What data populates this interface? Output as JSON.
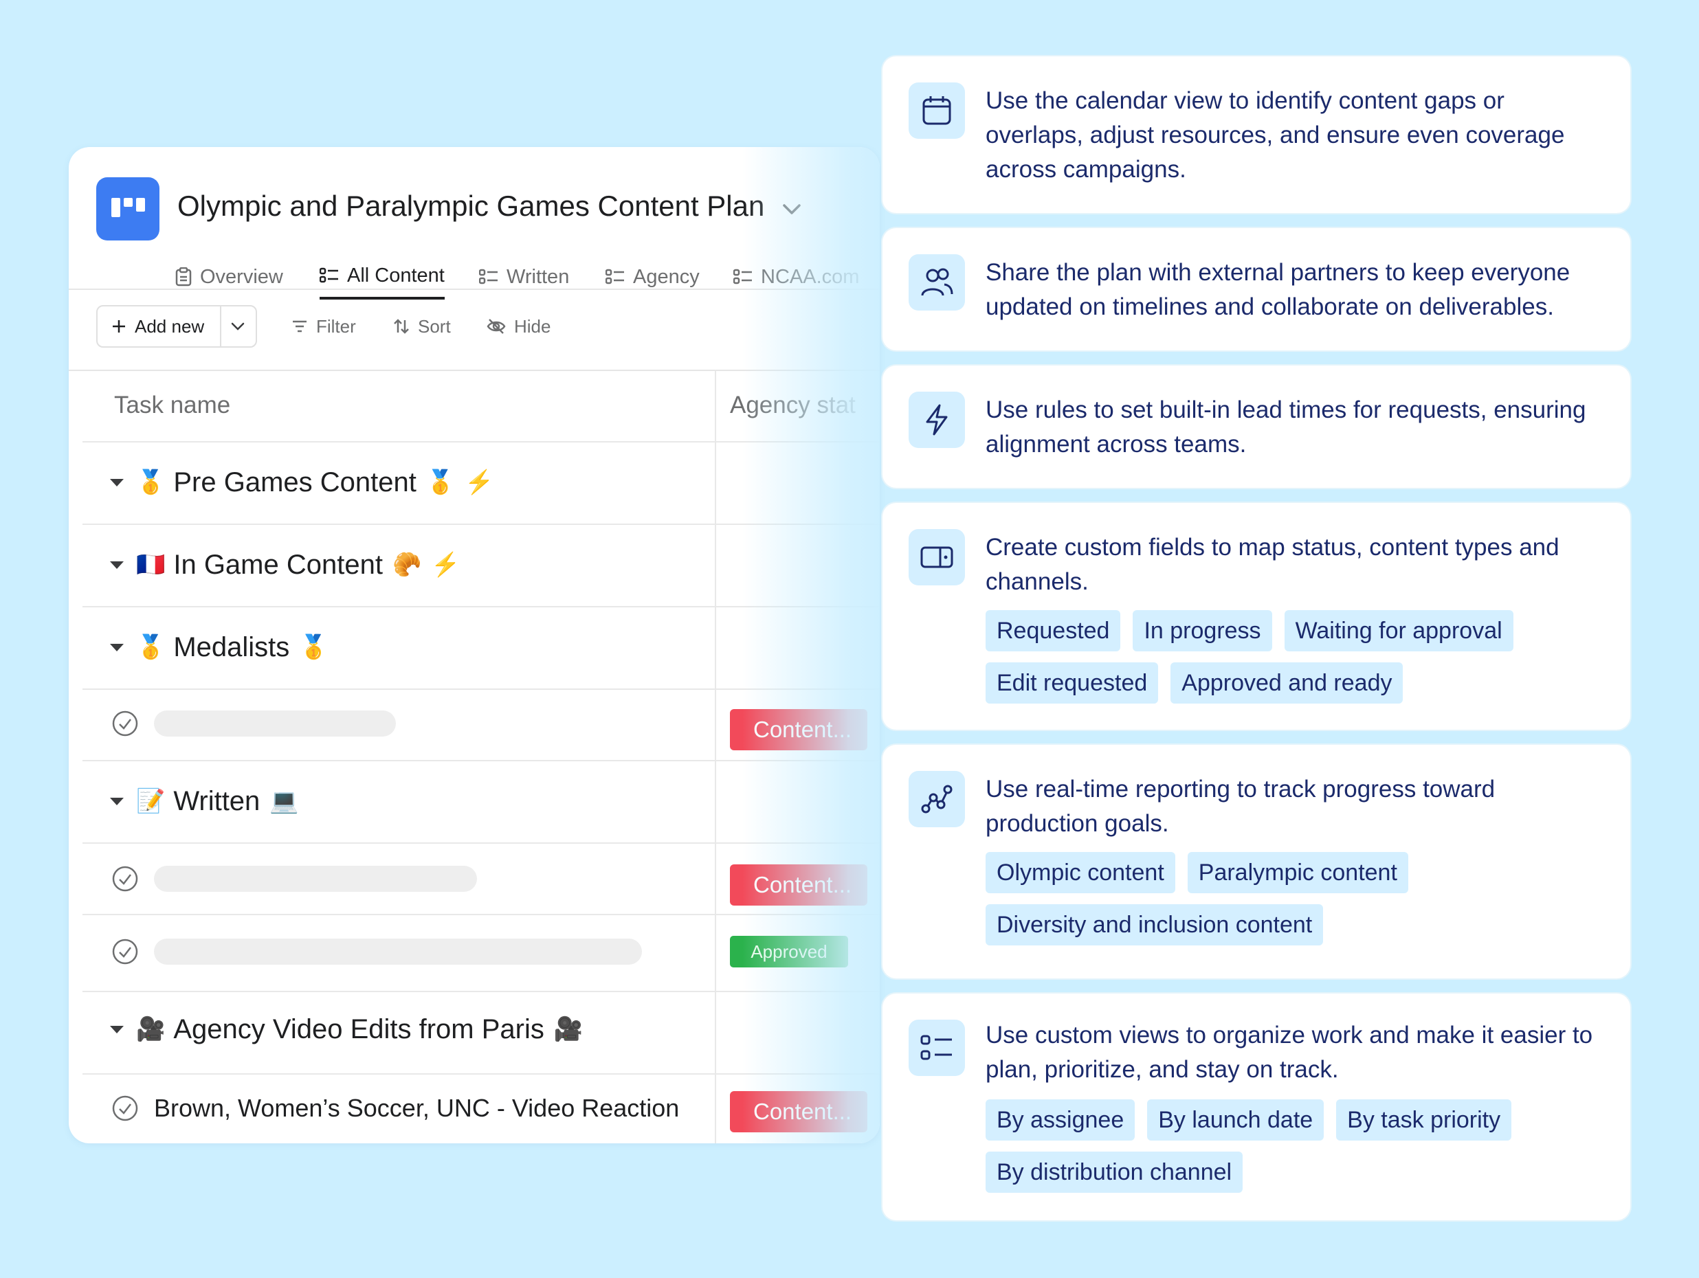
{
  "project": {
    "title": "Olympic and Paralympic Games Content Plan",
    "accent": "#3d7cf2"
  },
  "tabs": [
    {
      "label": "Overview",
      "icon": "overview-icon",
      "active": false
    },
    {
      "label": "All Content",
      "icon": "list-icon",
      "active": true
    },
    {
      "label": "Written",
      "icon": "list-icon",
      "active": false
    },
    {
      "label": "Agency",
      "icon": "list-icon",
      "active": false
    },
    {
      "label": "NCAA.com",
      "icon": "list-icon",
      "active": false
    }
  ],
  "toolbar": {
    "add_new": "Add new",
    "filter": "Filter",
    "sort": "Sort",
    "hide": "Hide"
  },
  "columns": {
    "task_name": "Task name",
    "agency_status": "Agency stat"
  },
  "groups": [
    {
      "label": "Pre Games Content",
      "emoji_left": "🥇",
      "emoji_right": "🥇",
      "emoji_extra": "⚡"
    },
    {
      "label": "In Game Content",
      "emoji_left": "🇫🇷",
      "emoji_right": "🥐",
      "emoji_extra": "⚡"
    },
    {
      "label": "Medalists",
      "emoji_left": "🥇",
      "emoji_right": "🥇"
    },
    {
      "label": "Written",
      "emoji_left": "📝",
      "emoji_right": "💻"
    },
    {
      "label": "Agency Video Edits from Paris",
      "emoji_left": "🎥",
      "emoji_right": "🎥"
    }
  ],
  "rows": [
    {
      "status": "Content..."
    },
    {
      "status": "Content..."
    },
    {
      "status": "Approved"
    },
    {
      "name": "Brown, Women’s Soccer, UNC - Video Reaction",
      "status": "Content..."
    }
  ],
  "status_colors": {
    "content": "#f24a5a",
    "approved": "#2bb24c"
  },
  "cards": [
    {
      "icon": "calendar-icon",
      "text": "Use the calendar view to identify content gaps or overlaps, adjust resources, and ensure even coverage across campaigns."
    },
    {
      "icon": "people-icon",
      "text": "Share the plan with external partners to keep everyone updated on timelines and collaborate on deliverables."
    },
    {
      "icon": "lightning-icon",
      "text": "Use rules to set built-in lead times for requests, ensuring alignment across teams."
    },
    {
      "icon": "custom-field-icon",
      "text": "Create custom fields to map status, content types and channels.",
      "chips": [
        "Requested",
        "In progress",
        "Waiting for approval",
        "Edit requested",
        "Approved and ready"
      ]
    },
    {
      "icon": "reporting-icon",
      "text": "Use real-time reporting to track progress toward production goals.",
      "chips": [
        "Olympic content",
        "Paralympic content",
        "Diversity and inclusion content"
      ]
    },
    {
      "icon": "views-icon",
      "text": "Use custom views to organize work and make it easier to plan, prioritize, and stay on track.",
      "chips": [
        "By assignee",
        "By launch date",
        "By task priority",
        "By distribution channel"
      ]
    }
  ]
}
